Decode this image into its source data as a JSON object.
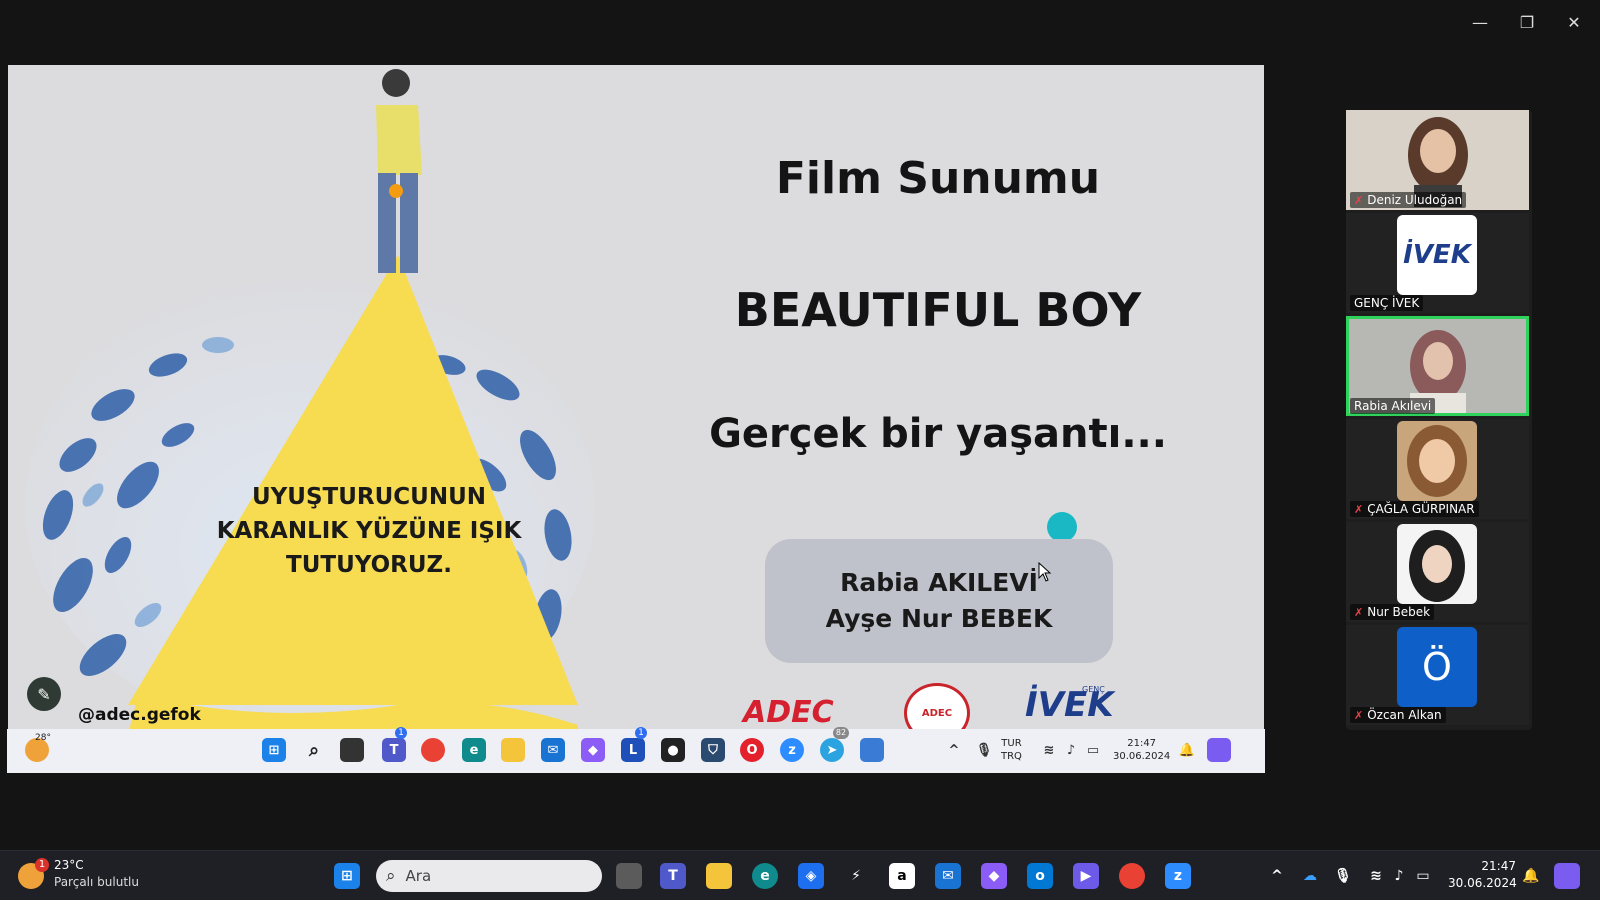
{
  "window": {
    "minimize_icon": "minimize-icon",
    "restore_icon": "restore-icon",
    "close_icon": "close-icon"
  },
  "slide": {
    "title": "Film Sunumu",
    "movie": "BEAUTIFUL BOY",
    "tagline": "Gerçek bir yaşantı...",
    "presenters": [
      "Rabia AKILEVİ",
      "Ayşe Nur BEBEK"
    ],
    "triangle_text": [
      "UYUŞTURUCUNUN",
      "KARANLIK YÜZÜNE IŞIK",
      "TUTUYORUZ."
    ],
    "handle": "@adec.gefok",
    "logos": {
      "adec": "ADEC",
      "adec_seal": "ADEC",
      "ivek": "İVEK",
      "ivek_small": "GENÇ"
    }
  },
  "remote_taskbar": {
    "weather_temp": "28°",
    "lang_top": "TUR",
    "lang_bottom": "TRQ",
    "time": "21:47",
    "date": "30.06.2024",
    "teams_badge": "1",
    "l_badge": "1",
    "telegram_badge": "82"
  },
  "participants": [
    {
      "name": "Deniz Uludoğan",
      "muted": true,
      "speaking": false
    },
    {
      "name": "GENÇ İVEK",
      "muted": false,
      "speaking": false
    },
    {
      "name": "Rabia Akılevi",
      "muted": false,
      "speaking": true
    },
    {
      "name": "ÇAĞLA GÜRPINAR",
      "muted": true,
      "speaking": false
    },
    {
      "name": "Nur Bebek",
      "muted": true,
      "speaking": false
    },
    {
      "name": "Özcan Alkan",
      "muted": true,
      "speaking": false,
      "avatar_letter": "Ö"
    }
  ],
  "local_taskbar": {
    "weather_temp": "23°C",
    "weather_desc": "Parçalı bulutlu",
    "weather_badge": "1",
    "search_placeholder": "Ara",
    "time": "21:47",
    "date": "30.06.2024"
  },
  "colors": {
    "speaking": "#2fd35c",
    "muted": "#e8434b",
    "slide_bg": "#dcdcdf",
    "triangle": "#f7dc52"
  }
}
